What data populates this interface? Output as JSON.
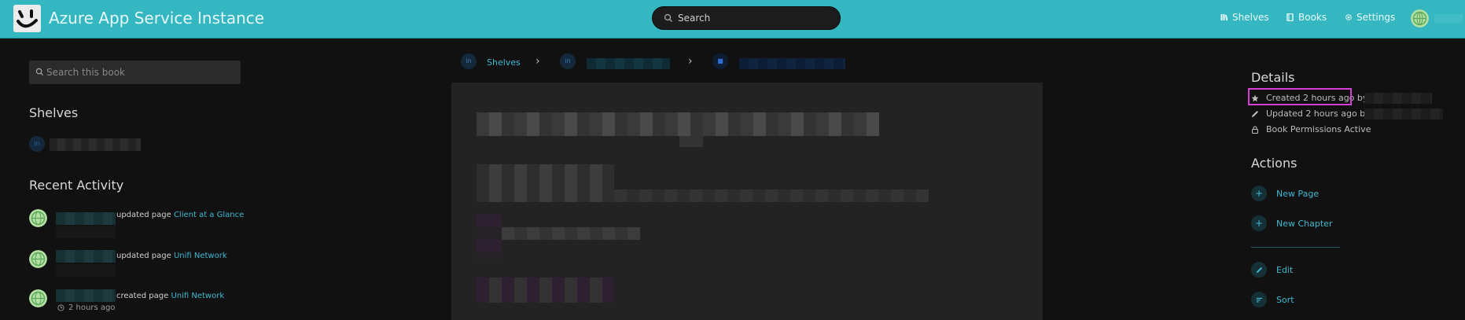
{
  "header": {
    "title": "Azure App Service Instance",
    "search_placeholder": "Search",
    "nav": {
      "shelves": "Shelves",
      "books": "Books",
      "settings": "Settings"
    }
  },
  "sidebar": {
    "search_placeholder": "Search this book",
    "shelves_heading": "Shelves",
    "shelf_chip": "in",
    "recent_activity_heading": "Recent Activity",
    "activity": [
      {
        "action": "updated page",
        "link": "Client at a Glance"
      },
      {
        "action": "updated page",
        "link": "Unifi Network"
      },
      {
        "action": "created page",
        "link": "Unifi Network",
        "time": "2 hours ago"
      }
    ]
  },
  "breadcrumb": {
    "shelves": "Shelves",
    "chip1": "in",
    "chip2": "in",
    "chip3": "■"
  },
  "details": {
    "heading": "Details",
    "created": "Created 2 hours ago by",
    "updated": "Updated 2 hours ago b",
    "permissions": "Book Permissions Active"
  },
  "actions": {
    "heading": "Actions",
    "new_page": "New Page",
    "new_chapter": "New Chapter",
    "edit": "Edit",
    "sort": "Sort"
  },
  "colors": {
    "header_bg": "#35b7c2",
    "link": "#3fb8d0",
    "highlight": "#d63ed6",
    "background": "#111111"
  }
}
